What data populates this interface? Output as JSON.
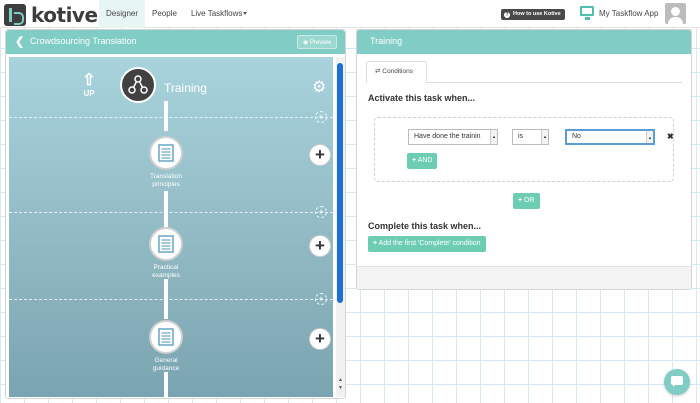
{
  "brand": {
    "name": "kotive"
  },
  "nav": {
    "items": [
      {
        "label": "Designer",
        "active": true
      },
      {
        "label": "People",
        "active": false
      },
      {
        "label": "Live Taskflows",
        "active": false
      }
    ]
  },
  "top_right": {
    "help_label": "How to use Kotive",
    "app_label": "My Taskflow App"
  },
  "left_panel": {
    "title": "Crowdsourcing Translation",
    "preview_label": "Preview",
    "up_label": "UP",
    "current_task": "Training",
    "tasks": [
      {
        "label_line1": "Translation",
        "label_line2": "principles"
      },
      {
        "label_line1": "Practical",
        "label_line2": "examples"
      },
      {
        "label_line1": "General",
        "label_line2": "guidance"
      }
    ]
  },
  "right_panel": {
    "title": "Training",
    "tab_label": "Conditions",
    "activate_heading": "Activate this task when...",
    "condition": {
      "field_value": "Have done the trainin",
      "operator_value": "is",
      "value_value": "No"
    },
    "and_label": "AND",
    "or_label": "OR",
    "complete_heading": "Complete this task when...",
    "add_complete_label": "Add the first 'Complete' condition"
  },
  "colors": {
    "accent": "#7fcdc4",
    "button": "#6dcdb2",
    "dark": "#414141"
  }
}
